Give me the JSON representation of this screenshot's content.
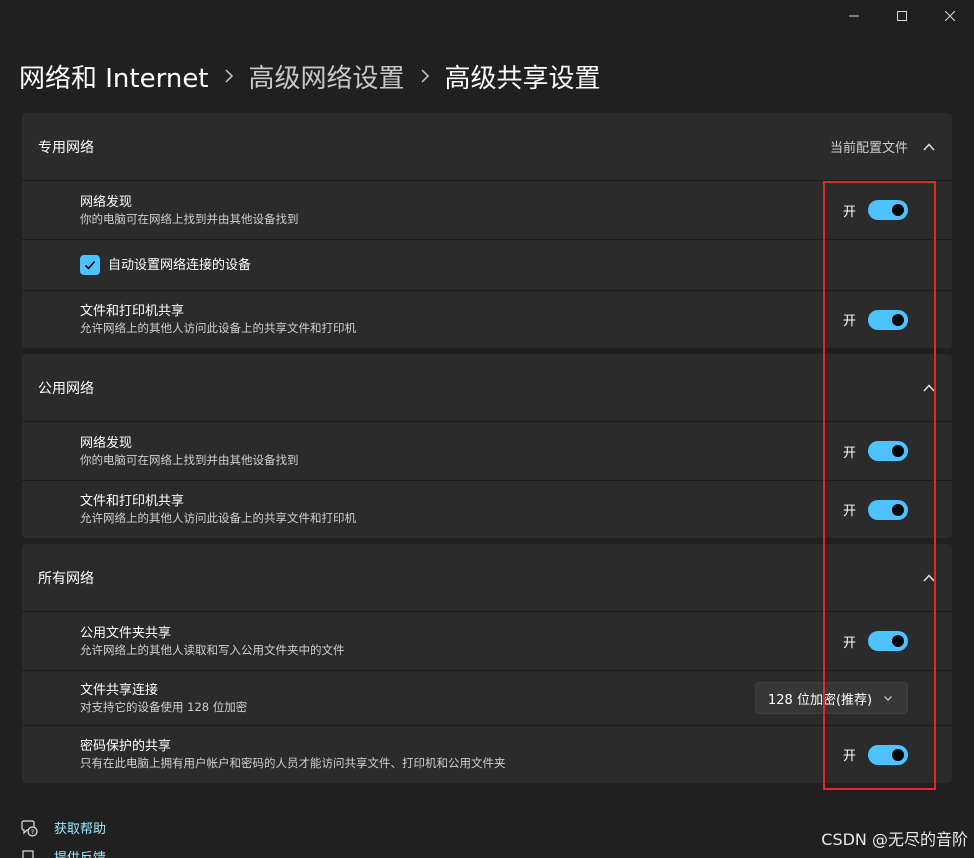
{
  "breadcrumb": {
    "items": [
      "网络和 Internet",
      "高级网络设置",
      "高级共享设置"
    ]
  },
  "sections": {
    "private": {
      "title": "专用网络",
      "subtitle": "当前配置文件",
      "discovery": {
        "title": "网络发现",
        "desc": "你的电脑可在网络上找到并由其他设备找到",
        "state": "开"
      },
      "auto_setup": {
        "label": "自动设置网络连接的设备",
        "checked": true
      },
      "file_sharing": {
        "title": "文件和打印机共享",
        "desc": "允许网络上的其他人访问此设备上的共享文件和打印机",
        "state": "开"
      }
    },
    "public": {
      "title": "公用网络",
      "discovery": {
        "title": "网络发现",
        "desc": "你的电脑可在网络上找到并由其他设备找到",
        "state": "开"
      },
      "file_sharing": {
        "title": "文件和打印机共享",
        "desc": "允许网络上的其他人访问此设备上的共享文件和打印机",
        "state": "开"
      }
    },
    "all": {
      "title": "所有网络",
      "public_folder": {
        "title": "公用文件夹共享",
        "desc": "允许网络上的其他人读取和写入公用文件夹中的文件",
        "state": "开"
      },
      "connection": {
        "title": "文件共享连接",
        "desc": "对支持它的设备使用 128 位加密",
        "value": "128 位加密(推荐)"
      },
      "password": {
        "title": "密码保护的共享",
        "desc": "只有在此电脑上拥有用户帐户和密码的人员才能访问共享文件、打印机和公用文件夹",
        "state": "开"
      }
    }
  },
  "footer": {
    "help": "获取帮助",
    "feedback": "提供反馈"
  },
  "watermark": "CSDN @无尽的音阶",
  "colors": {
    "accent": "#4cc2ff",
    "annotation": "#e3262d",
    "background": "#202020",
    "card": "#2b2b2b",
    "link": "#99ebff"
  },
  "icons": [
    "minimize-icon",
    "maximize-icon",
    "close-icon",
    "chevron-right-icon",
    "chevron-up-icon",
    "chevron-down-icon",
    "checkmark-icon",
    "help-icon",
    "feedback-icon"
  ]
}
